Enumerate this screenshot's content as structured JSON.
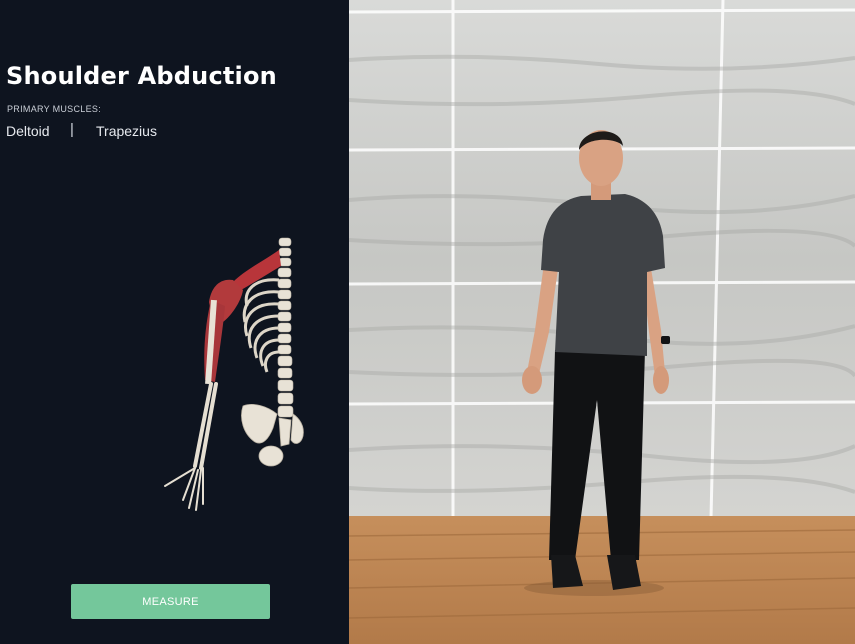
{
  "exercise": {
    "title": "Shoulder Abduction",
    "muscles_caption": "PRIMARY MUSCLES:",
    "muscles": [
      "Deltoid",
      "Trapezius"
    ],
    "separator": "|"
  },
  "actions": {
    "measure_label": "MEASURE"
  },
  "colors": {
    "panel_background": "#0e141f",
    "accent_button": "#74c79b",
    "muscle_red": "#b8353a"
  }
}
